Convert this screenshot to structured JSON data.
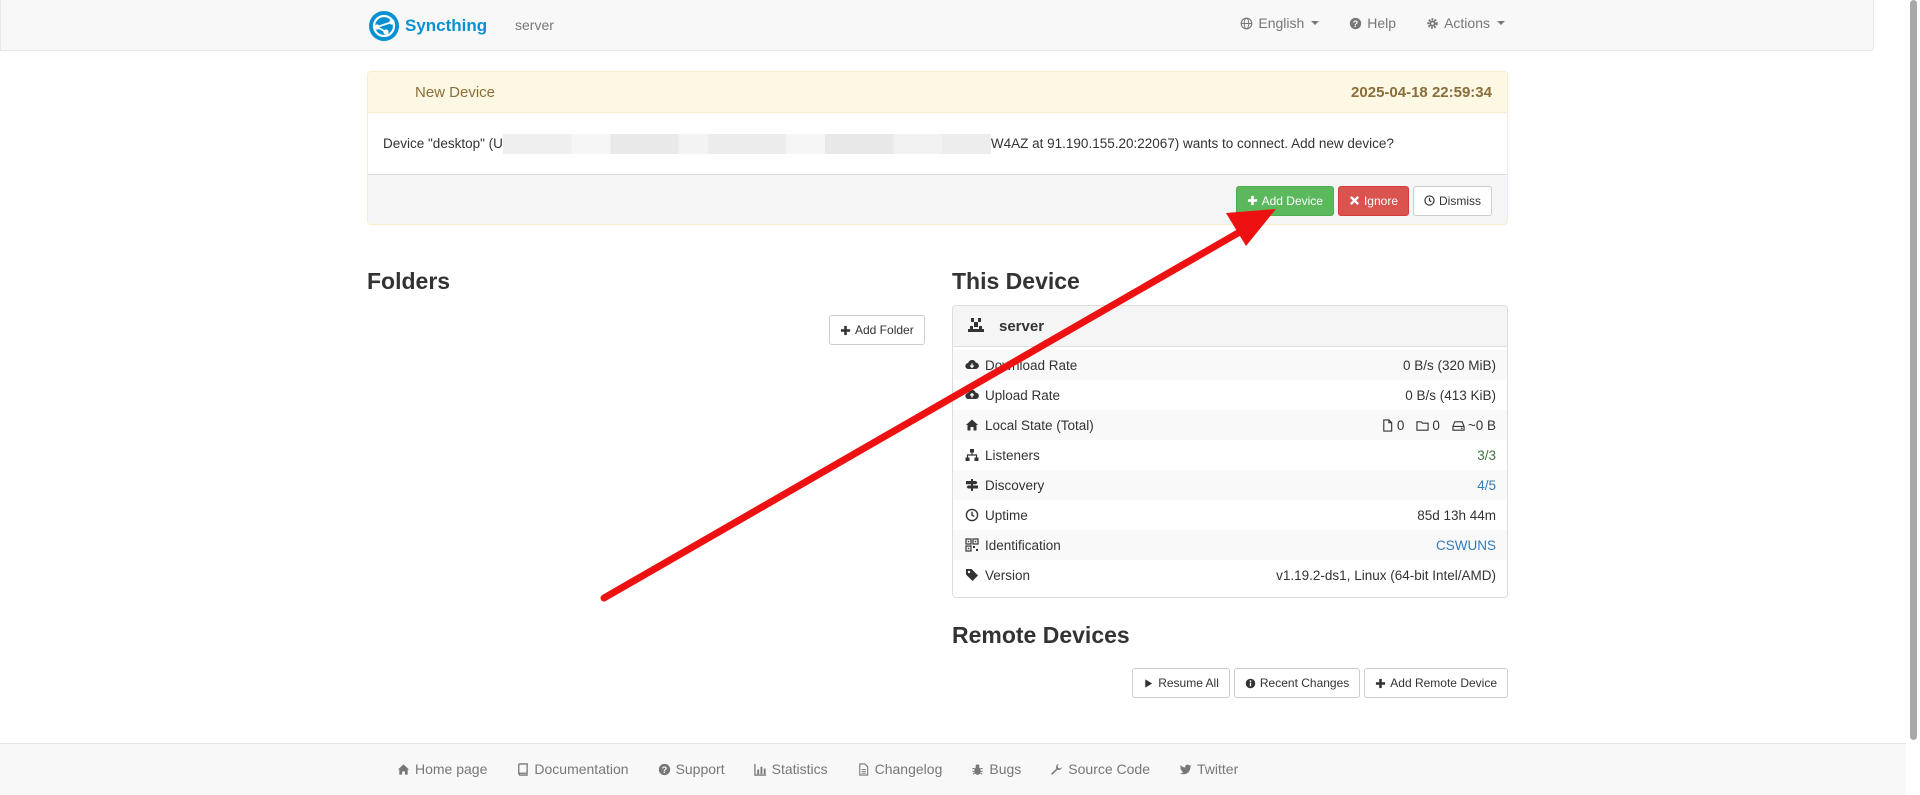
{
  "navbar": {
    "brand": "Syncthing",
    "host": "server",
    "language": "English",
    "help": "Help",
    "actions": "Actions"
  },
  "notification": {
    "title": "New Device",
    "timestamp": "2025-04-18 22:59:34",
    "message_prefix": "Device \"desktop\" (U",
    "message_suffix": "W4AZ at 91.190.155.20:22067) wants to connect. Add new device?",
    "buttons": {
      "add": "Add Device",
      "ignore": "Ignore",
      "dismiss": "Dismiss"
    }
  },
  "folders": {
    "title": "Folders",
    "add_label": "Add Folder"
  },
  "this_device": {
    "title": "This Device",
    "name": "server",
    "rows": {
      "download": {
        "label": "Download Rate",
        "value": "0 B/s (320 MiB)"
      },
      "upload": {
        "label": "Upload Rate",
        "value": "0 B/s (413 KiB)"
      },
      "local_state": {
        "label": "Local State (Total)",
        "files": "0",
        "dirs": "0",
        "size": "~0 B"
      },
      "listeners": {
        "label": "Listeners",
        "value": "3/3"
      },
      "discovery": {
        "label": "Discovery",
        "value": "4/5"
      },
      "uptime": {
        "label": "Uptime",
        "value": "85d 13h 44m"
      },
      "identification": {
        "label": "Identification",
        "value": "CSWUNS"
      },
      "version": {
        "label": "Version",
        "value": "v1.19.2-ds1, Linux (64-bit Intel/AMD)"
      }
    }
  },
  "remote_devices": {
    "title": "Remote Devices",
    "buttons": {
      "resume": "Resume All",
      "recent": "Recent Changes",
      "add": "Add Remote Device"
    }
  },
  "footer": {
    "links": {
      "home": "Home page",
      "docs": "Documentation",
      "support": "Support",
      "stats": "Statistics",
      "changelog": "Changelog",
      "bugs": "Bugs",
      "source": "Source Code",
      "twitter": "Twitter"
    }
  },
  "colors": {
    "brand": "#0891d1",
    "success": "#5cb85c",
    "danger": "#d9534f",
    "warning_bg": "#fcf8e3",
    "annotation_arrow": "#ee1111"
  }
}
